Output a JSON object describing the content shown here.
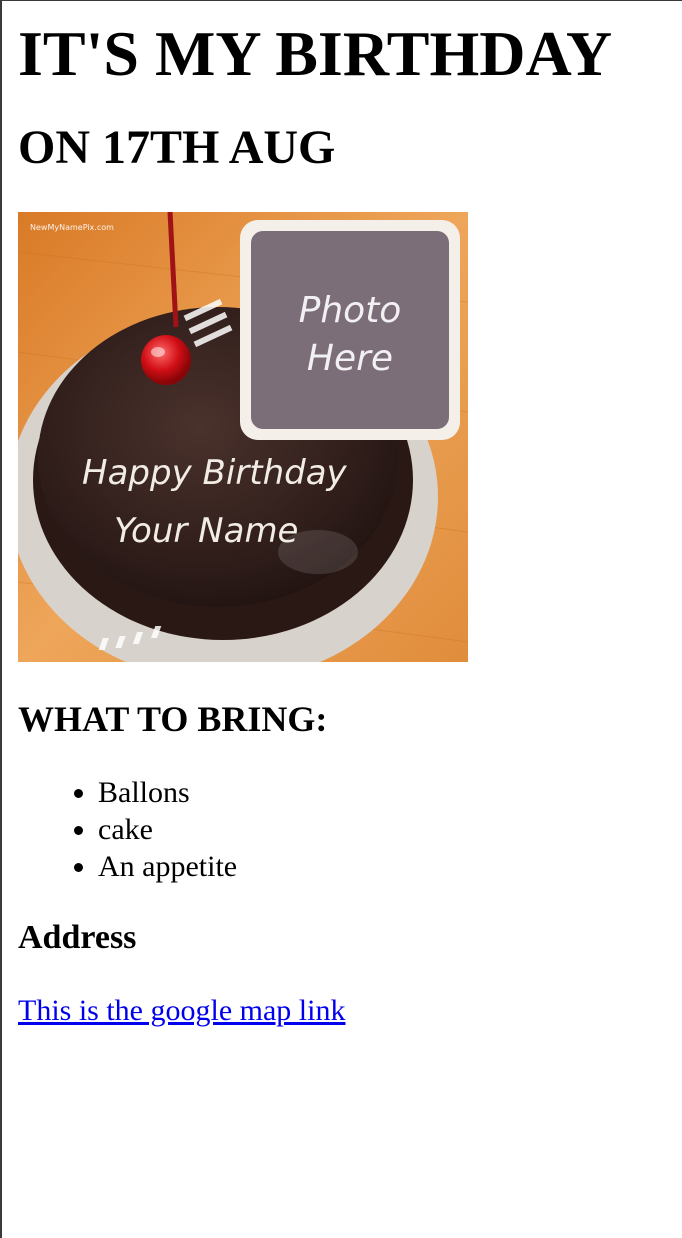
{
  "page": {
    "title": "IT'S MY BIRTHDAY",
    "date_heading": "ON 17TH AUG"
  },
  "image": {
    "watermark": "NewMyNamePix.com",
    "photo_placeholder_line1": "Photo",
    "photo_placeholder_line2": "Here",
    "cake_text_line1": "Happy Birthday",
    "cake_text_line2": "Your Name"
  },
  "bring": {
    "heading": "WHAT TO BRING:",
    "items": [
      "Ballons",
      "cake",
      "An appetite"
    ]
  },
  "address": {
    "heading": "Address",
    "link_text": "This is the google map link"
  },
  "colors": {
    "link": "#0000ee",
    "table_wood": "#e9953a",
    "chocolate": "#3a2622",
    "photo_frame": "#7b6e78"
  }
}
